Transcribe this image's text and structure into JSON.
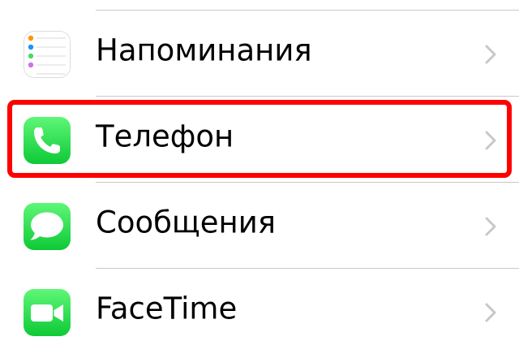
{
  "settings": {
    "items": [
      {
        "label": "Напоминания",
        "icon": "reminders-icon"
      },
      {
        "label": "Телефон",
        "icon": "phone-icon"
      },
      {
        "label": "Сообщения",
        "icon": "messages-icon"
      },
      {
        "label": "FaceTime",
        "icon": "facetime-icon"
      }
    ],
    "highlighted_item": "Телефон"
  },
  "colors": {
    "highlight": "#ff0000",
    "green_top": "#5ef777",
    "green_bottom": "#0ec936",
    "separator": "#c8c7cc",
    "chevron": "#c7c7cc"
  }
}
